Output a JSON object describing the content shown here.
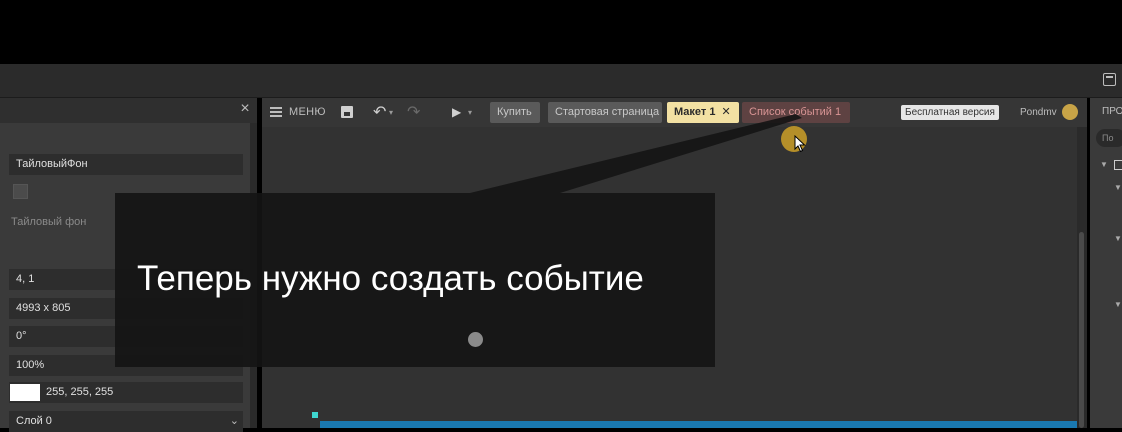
{
  "left_panel": {
    "fields": {
      "name": "ТайловыйФон",
      "position": "4,  1",
      "size": "4993 x 805",
      "angle": "0°",
      "opacity": "100%",
      "color_value": "255, 255, 255",
      "layer": "Слой 0"
    },
    "tiled_bg_label": "Тайловый фон"
  },
  "toolbar": {
    "menu_label": "МЕНЮ",
    "tabs": {
      "buy": "Купить",
      "start_page": "Стартовая страница",
      "layout": "Макет 1",
      "layout_close": "✕",
      "events": "Список событий 1"
    },
    "free_version": "Бесплатная версия",
    "user_name": "Pondmv"
  },
  "right_panel": {
    "title": "ПРО",
    "search_placeholder": "По"
  },
  "overlay": {
    "subtitle": "Теперь нужно создать событие"
  },
  "icons": {
    "close": "close-icon",
    "menu": "hamburger-icon",
    "save": "save-icon",
    "undo": "undo-icon",
    "redo": "redo-icon",
    "play": "play-icon",
    "user": "user-avatar-icon"
  },
  "colors": {
    "layout_tab": "#f3e1a3",
    "events_tab": "#5e4242",
    "canvas": "#323232",
    "selected_strip": "#1a78b0",
    "swatch": "#ffffff"
  }
}
